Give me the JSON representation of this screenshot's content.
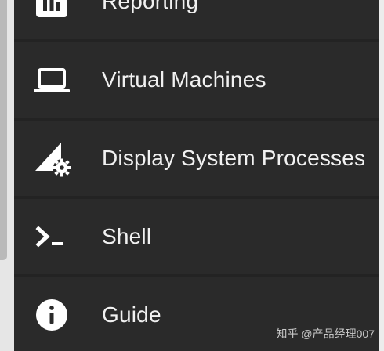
{
  "menu": {
    "items": [
      {
        "label": "Reporting",
        "icon": "bar-chart-icon"
      },
      {
        "label": "Virtual Machines",
        "icon": "laptop-icon"
      },
      {
        "label": "Display System Processes",
        "icon": "system-processes-icon"
      },
      {
        "label": "Shell",
        "icon": "terminal-icon"
      },
      {
        "label": "Guide",
        "icon": "info-icon"
      }
    ]
  },
  "watermark": {
    "text": "知乎 @产品经理007"
  },
  "colors": {
    "background": "#2a2a2a",
    "divider": "#232323",
    "text": "#f1f1f1",
    "left_strip": "#e6e6e6",
    "scroll_thumb": "#b9b9b9"
  }
}
